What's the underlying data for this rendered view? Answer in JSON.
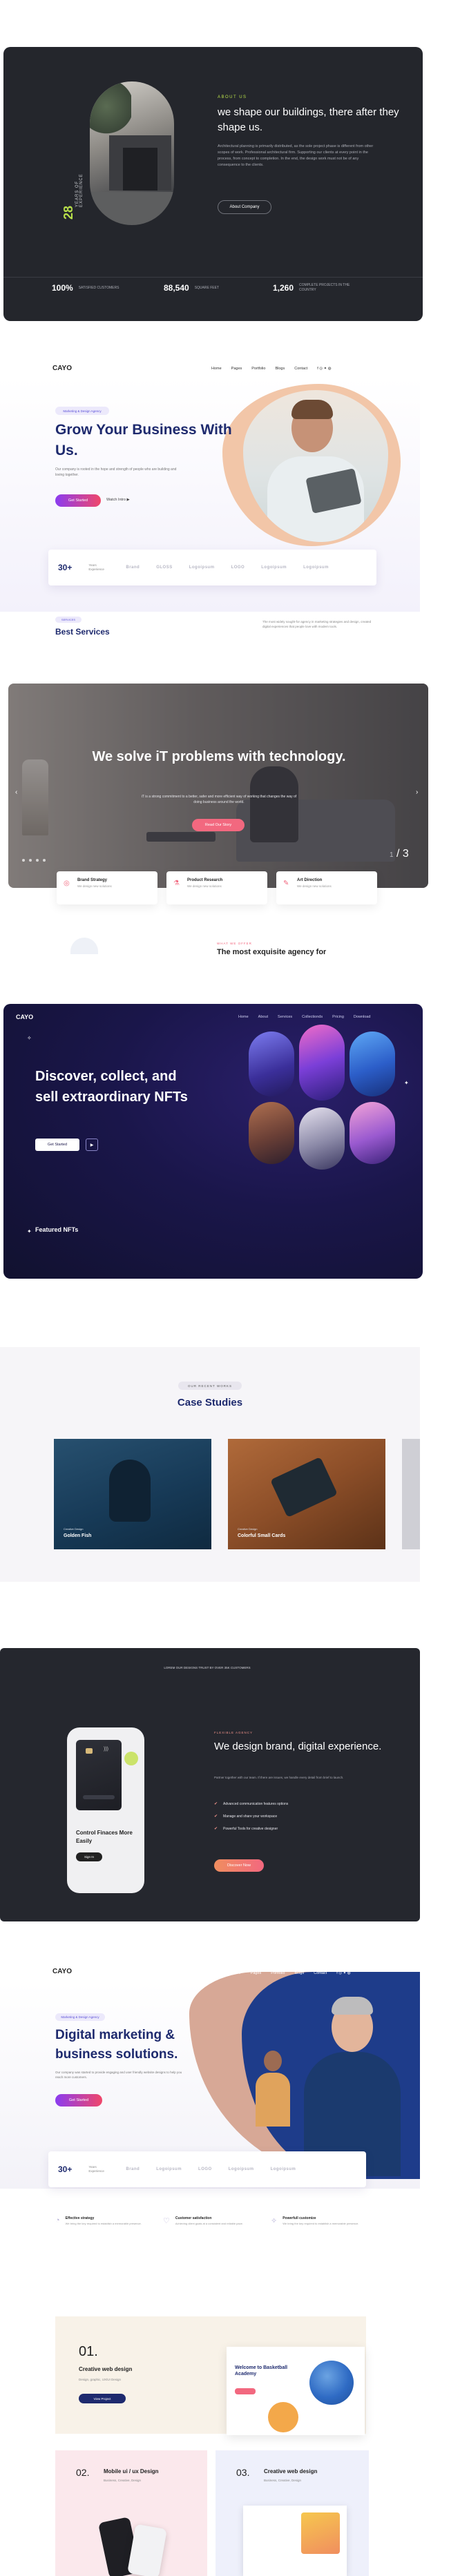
{
  "about": {
    "eyebrow": "ABOUT US",
    "heading": "we shape our buildings, there after they shape us.",
    "paragraph": "Architectural planning is primarily distributed, as the sole project phase is different from other scopes of work. Professional architectural firm. Supporting our clients at every point in the process, from concept to completion. In the end, the design work must not be of any consequence to the clients.",
    "button": "About Company",
    "years_number": "28",
    "years_label": "YEARS OF EXPERIENCE",
    "stats": [
      {
        "number": "100%",
        "label": "SATISFIED CUSTOMERS"
      },
      {
        "number": "88,540",
        "label": "SQUARE FEET"
      },
      {
        "number": "1,260",
        "label": "COMPLETE PROJECTS IN THE COUNTRY"
      }
    ]
  },
  "business": {
    "logo": "CAYO",
    "nav": [
      "Home",
      "Pages",
      "Portfolio",
      "Blogs",
      "Contact"
    ],
    "badge": "Marketing & Design Agency",
    "heading": "Grow Your Business With Us.",
    "paragraph": "Our company is rooted in the hope and strength of people who are building and loving together.",
    "primary_button": "Get Started",
    "secondary_button": "Watch Intro",
    "stat_number": "30+",
    "stat_label": "Years Experience",
    "brands": [
      "Brand",
      "GLOSS",
      "Logoipsum",
      "LOGO",
      "Logoipsum",
      "Logoipsum"
    ],
    "sub_badge": "SERVICES",
    "sub_heading": "Best Services",
    "sub_paragraph": "The most widely sought-for agency in marketing strategies and design, created digital experiences that people love with modern tools."
  },
  "slider": {
    "heading": "We solve iT problems with technology.",
    "paragraph": "iT is a strong commitment to a better, safer and more efficient way of working that changes the way of doing business around the world.",
    "button": "Read Our Story",
    "counter_current": "1",
    "counter_total": "3",
    "cards": [
      {
        "title": "Brand Strategy",
        "desc": "We design new solutions",
        "icon": "target-icon"
      },
      {
        "title": "Product Research",
        "desc": "We design new solutions",
        "icon": "flask-icon"
      },
      {
        "title": "Art Direction",
        "desc": "We design new solutions",
        "icon": "pen-icon"
      }
    ],
    "next_eyebrow": "WHAT WE OFFER",
    "next_heading": "The most exquisite agency for"
  },
  "nft": {
    "logo": "CAYO",
    "nav": [
      "Home",
      "About",
      "Services",
      "Collectionds",
      "Pricing",
      "Download"
    ],
    "heading": "Discover, collect, and sell extraordinary NFTs",
    "primary_button": "Get Started",
    "featured": "Featured NFTs",
    "colors": {
      "bg": "#1a164a"
    }
  },
  "case": {
    "eyebrow": "OUR RECENT WORKS",
    "heading": "Case Studies",
    "items": [
      {
        "category": "Creative Design",
        "title": "Golden Fish"
      },
      {
        "category": "Creative Design",
        "title": "Colorful Small Cards"
      }
    ]
  },
  "brand": {
    "top_text": "LOREM OUR DESIGNS TRUST BY OVER 35K CUSTOMERS",
    "card_title": "Control Finaces More Easily",
    "card_button": "Sign In",
    "eyebrow": "FLEXIBLE AGENCY",
    "heading": "We design brand, digital experience.",
    "paragraph": "Partner together with our team. If there are issues, we handle every detail from brief to launch.",
    "list": [
      "Advanced communication features options",
      "Manage and share your workspace",
      "Powerful Tools for creative designer"
    ],
    "button": "Discover Now"
  },
  "marketing": {
    "logo": "CAYO",
    "nav": [
      "Home",
      "Pages",
      "Portfolio",
      "Blogs",
      "Contact"
    ],
    "badge": "Marketing & Design Agency",
    "heading": "Digital marketing & business solutions.",
    "paragraph": "Our company was started to provide engaging and user friendly website designs to help you reach more customers.",
    "button": "Get Started",
    "stat_number": "30+",
    "stat_label": "Years Experience",
    "brands": [
      "Brand",
      "Logoipsum",
      "LOGO",
      "Logoipsum",
      "Logoipsum"
    ],
    "services": [
      {
        "title": "Effective strategy",
        "desc": "We bring the key required to establish a memorable presence."
      },
      {
        "title": "Customer satisfaction",
        "desc": "Achieving client goals at a consistent and reliable pace."
      },
      {
        "title": "Powerfull customize",
        "desc": "We bring the key required to establish a memorable presence."
      }
    ]
  },
  "creative": {
    "items": [
      {
        "number": "01.",
        "title": "Creative web design",
        "subtitle": "Design, graphic, UX/UI Design",
        "button": "View Project"
      },
      {
        "number": "02.",
        "title": "Mobile ui / ux Design",
        "subtitle": "Business, Creative, Design"
      },
      {
        "number": "03.",
        "title": "Creative web design",
        "subtitle": "Business, Creative, Design"
      }
    ],
    "preview_title": "Welcome to Basketball Academy"
  }
}
